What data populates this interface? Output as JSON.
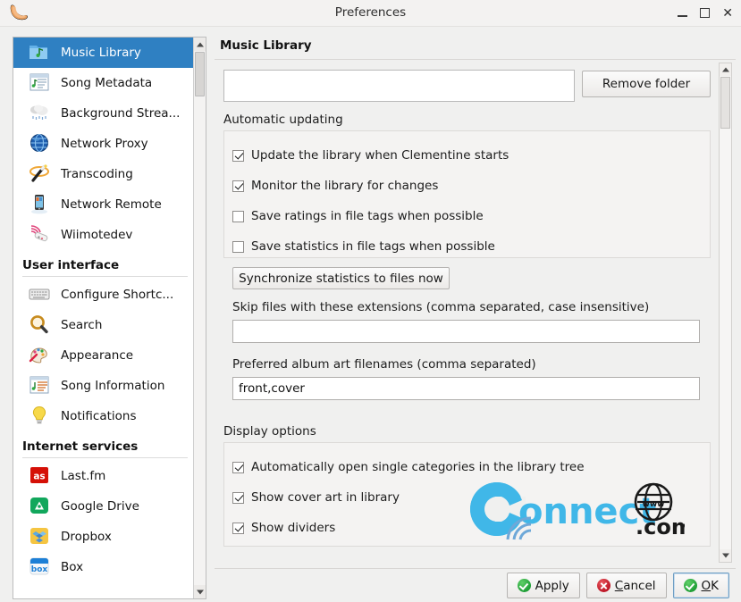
{
  "window": {
    "title": "Preferences",
    "logo_icon": "clementine-logo-icon",
    "minimize_label": "–",
    "maximize_label": "□",
    "close_label": "✕"
  },
  "sidebar": {
    "items": [
      {
        "label": "Music Library",
        "icon": "music-folder-icon",
        "selected": true
      },
      {
        "label": "Song Metadata",
        "icon": "song-metadata-icon",
        "selected": false
      },
      {
        "label": "Background Strea...",
        "icon": "rain-cloud-icon",
        "selected": false
      },
      {
        "label": "Network Proxy",
        "icon": "globe-icon",
        "selected": false
      },
      {
        "label": "Transcoding",
        "icon": "magic-wand-icon",
        "selected": false
      },
      {
        "label": "Network Remote",
        "icon": "phone-icon",
        "selected": false
      },
      {
        "label": "Wiimotedev",
        "icon": "wii-remote-icon",
        "selected": false
      }
    ],
    "groups": [
      {
        "title": "User interface",
        "items": [
          {
            "label": "Configure Shortc...",
            "icon": "keyboard-icon"
          },
          {
            "label": "Search",
            "icon": "magnifier-icon"
          },
          {
            "label": "Appearance",
            "icon": "paint-palette-icon"
          },
          {
            "label": "Song Information",
            "icon": "song-info-icon"
          },
          {
            "label": "Notifications",
            "icon": "lightbulb-icon"
          }
        ]
      },
      {
        "title": "Internet services",
        "items": [
          {
            "label": "Last.fm",
            "icon": "lastfm-icon"
          },
          {
            "label": "Google Drive",
            "icon": "google-drive-icon"
          },
          {
            "label": "Dropbox",
            "icon": "dropbox-icon"
          },
          {
            "label": "Box",
            "icon": "box-icon"
          }
        ]
      }
    ],
    "scrollbar": {
      "up_icon": "scroll-up-arrow-icon",
      "down_icon": "scroll-down-arrow-icon"
    }
  },
  "main": {
    "page_title": "Music Library",
    "folder_list_value": "",
    "remove_folder_label": "Remove folder",
    "automatic_updating": {
      "title": "Automatic updating",
      "checkboxes": [
        {
          "label": "Update the library when Clementine starts",
          "checked": true
        },
        {
          "label": "Monitor the library for changes",
          "checked": true
        },
        {
          "label": "Save ratings in file tags when possible",
          "checked": false
        },
        {
          "label": "Save statistics in file tags when possible",
          "checked": false
        }
      ],
      "sync_button_label": "Synchronize statistics to files now",
      "skip_files_label": "Skip files with these extensions (comma separated, case insensitive)",
      "skip_files_value": "",
      "album_art_label": "Preferred album art filenames (comma separated)",
      "album_art_value": "front,cover"
    },
    "display_options": {
      "title": "Display options",
      "checkboxes": [
        {
          "label": "Automatically open single categories in the library tree",
          "checked": true
        },
        {
          "label": "Show cover art in library",
          "checked": true
        },
        {
          "label": "Show dividers",
          "checked": true
        }
      ]
    },
    "watermark": {
      "text_primary": "onnect",
      "text_secondary": ".com",
      "globe_label": "www",
      "color": "#40b7e8"
    },
    "scrollbar": {
      "up_icon": "scroll-up-arrow-icon",
      "down_icon": "scroll-down-arrow-icon"
    }
  },
  "footer": {
    "apply_label": "Apply",
    "cancel_label": "Cancel",
    "cancel_accel": "C",
    "cancel_rest": "ancel",
    "ok_label": "OK",
    "ok_accel": "O",
    "ok_rest": "K"
  },
  "colors": {
    "selection_blue": "#2f80c2",
    "watermark_blue": "#40b7e8",
    "window_bg": "#f0f0ef"
  }
}
